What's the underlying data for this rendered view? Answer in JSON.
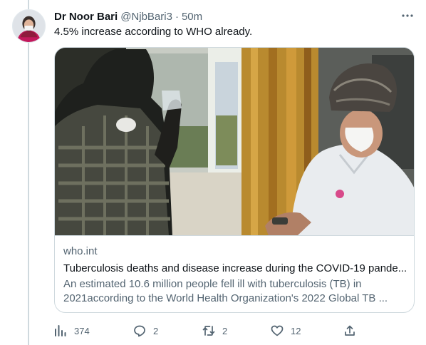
{
  "tweet": {
    "display_name": "Dr Noor Bari",
    "handle": "@NjbBari3",
    "separator": "·",
    "time": "50m",
    "text": "4.5% increase according to WHO already."
  },
  "card": {
    "domain": "who.int",
    "title": "Tuberculosis deaths and disease increase during the COVID-19 pande...",
    "description_line1": "An estimated 10.6 million people fell ill with tuberculosis (TB) in",
    "description_line2": "2021according to the World Health Organization's 2022 Global TB ..."
  },
  "actions": {
    "views": "374",
    "replies": "2",
    "retweets": "2",
    "likes": "12"
  },
  "icons": {
    "more": "more-horizontal-icon",
    "views": "analytics-icon",
    "reply": "reply-icon",
    "retweet": "retweet-icon",
    "like": "heart-icon",
    "share": "share-icon"
  },
  "colors": {
    "primary_text": "#0f1419",
    "secondary_text": "#536471",
    "border": "#cfd9de"
  }
}
